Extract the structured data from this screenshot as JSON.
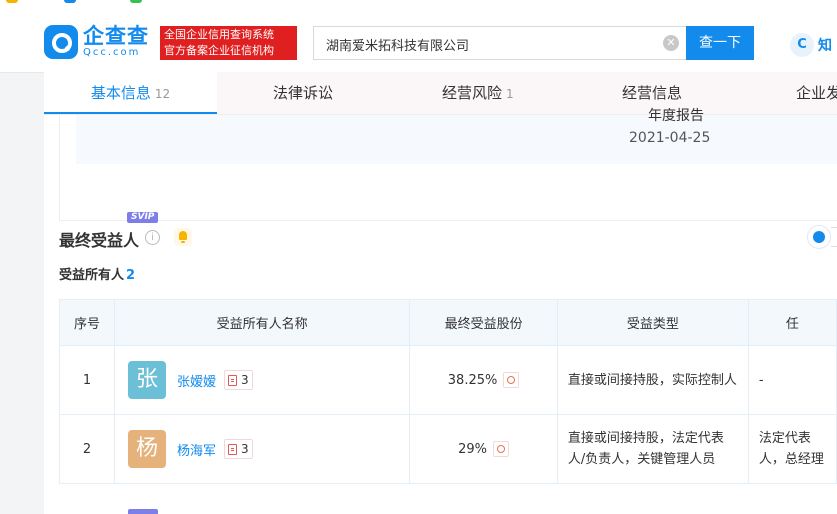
{
  "bookmarks": [
    {
      "label": "",
      "color": "#f5b400"
    },
    {
      "label": "",
      "color": "#128bed"
    },
    {
      "label": "",
      "color": "#33c24f"
    }
  ],
  "header": {
    "logo_cn": "企查查",
    "logo_en": "Qcc.com",
    "badge_line1": "全国企业信用查询系统",
    "badge_line2": "官方备案企业征信机构",
    "search_value": "湖南爱米拓科技有限公司",
    "search_button": "查一下",
    "right_label": "知",
    "right_icon_text": "C"
  },
  "tabs": [
    {
      "label": "基本信息",
      "count": "12"
    },
    {
      "label": "法律诉讼",
      "count": ""
    },
    {
      "label": "经营风险",
      "count": "1"
    },
    {
      "label": "经营信息",
      "count": ""
    },
    {
      "label": "企业发",
      "count": ""
    }
  ],
  "prev_section": {
    "cut_text": "年度报告",
    "date": "2021-04-25"
  },
  "beneficiary": {
    "title": "最终受益人",
    "badge": "SVIP",
    "owner_label": "受益所有人",
    "owner_count": "2",
    "columns": [
      "序号",
      "受益所有人名称",
      "最终受益股份",
      "受益类型",
      "任"
    ],
    "rows": [
      {
        "idx": "1",
        "avatar_char": "张",
        "avatar_color": "#6bbfd6",
        "name": "张嫒嫒",
        "docs": "3",
        "share": "38.25%",
        "type": "直接或间接持股，实际控制人",
        "last": "-"
      },
      {
        "idx": "2",
        "avatar_char": "杨",
        "avatar_color": "#e5b27c",
        "name": "杨海军",
        "docs": "3",
        "share": "29%",
        "type": "直接或间接持股，法定代表人/负责人，关键管理人员",
        "last": "法定代表人，总经理"
      }
    ]
  }
}
